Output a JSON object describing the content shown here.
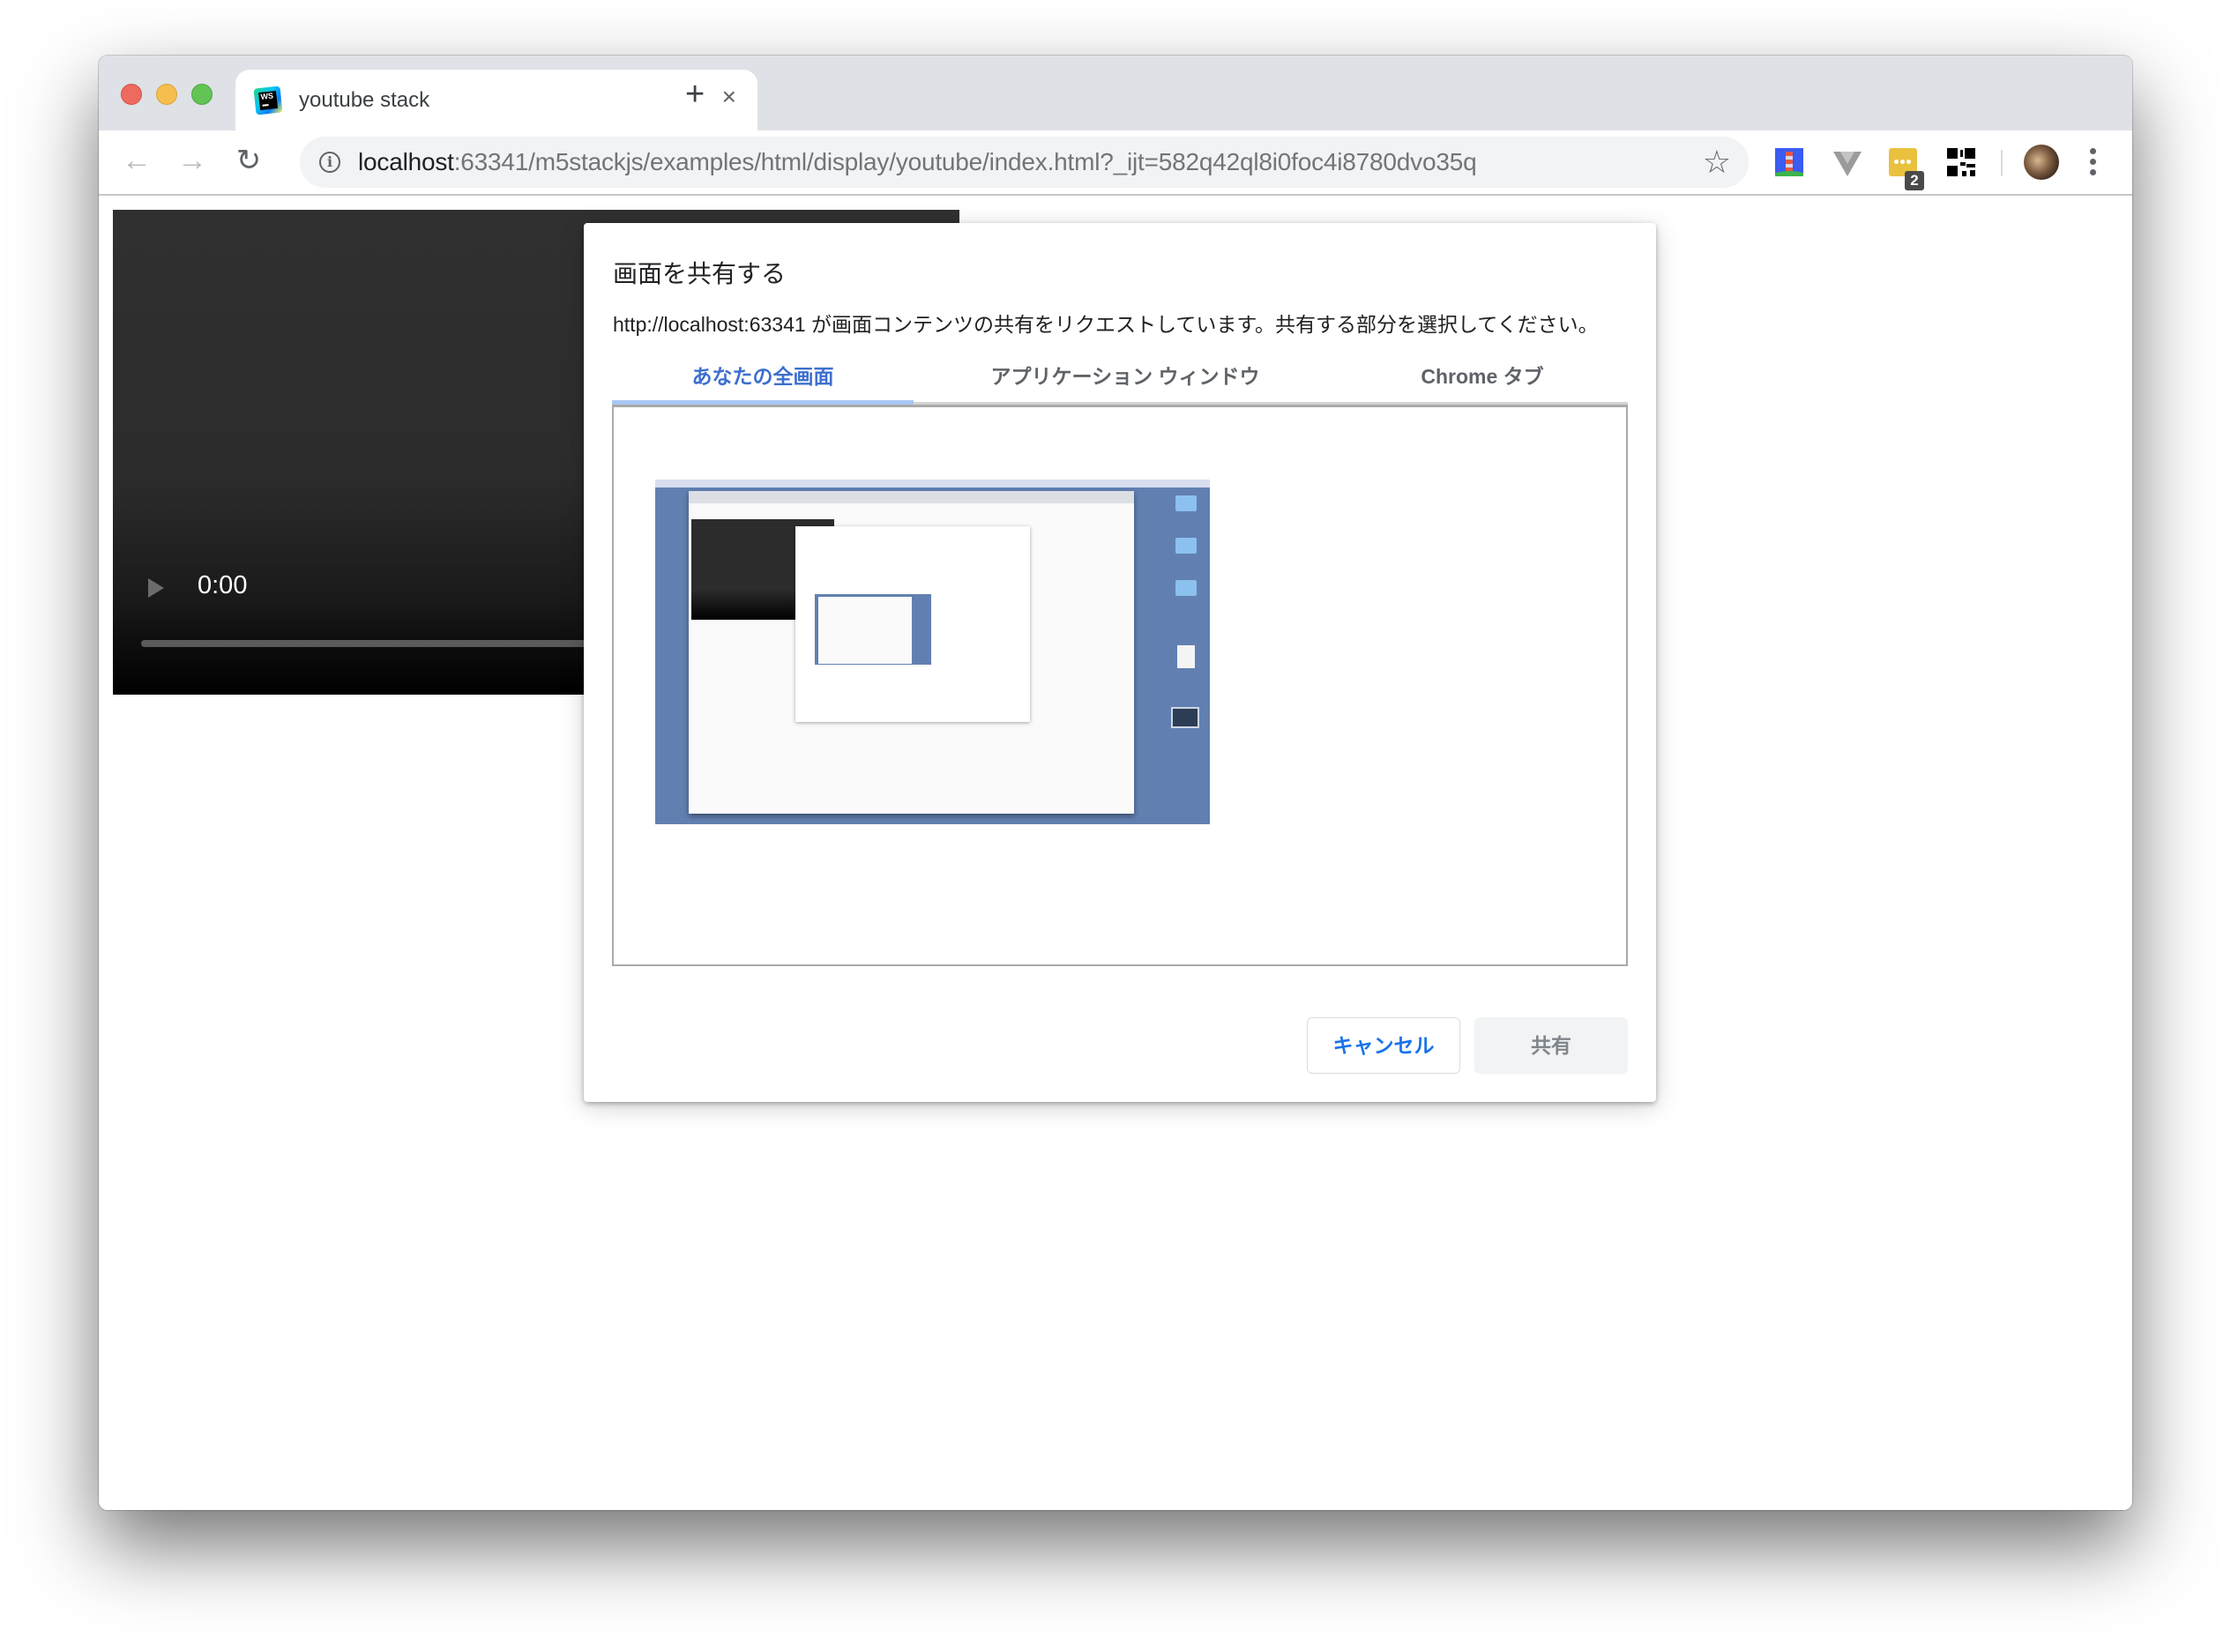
{
  "browser": {
    "tab": {
      "title": "youtube stack",
      "favicon": "webstorm-icon",
      "close_glyph": "×"
    },
    "new_tab_glyph": "+",
    "nav": {
      "back_glyph": "←",
      "forward_glyph": "→",
      "reload_glyph": "↻"
    },
    "omnibox": {
      "info_glyph": "i",
      "url_host": "localhost",
      "url_rest": ":63341/m5stackjs/examples/html/display/youtube/index.html?_ijt=582q42ql8i0foc4i8780dvo35q",
      "star_glyph": "☆"
    },
    "extensions": [
      {
        "name": "lighthouse-extension-icon"
      },
      {
        "name": "vue-devtools-extension-icon"
      },
      {
        "name": "ellipsis-extension-icon",
        "badge": "2"
      },
      {
        "name": "qr-code-extension-icon"
      }
    ],
    "menu_glyph": "⋮"
  },
  "video": {
    "time": "0:00",
    "progress": 0
  },
  "dialog": {
    "title": "画面を共有する",
    "description": "http://localhost:63341 が画面コンテンツの共有をリクエストしています。共有する部分を選択してください。",
    "tabs": [
      {
        "label": "あなたの全画面",
        "selected": true
      },
      {
        "label": "アプリケーション ウィンドウ",
        "selected": false
      },
      {
        "label": "Chrome タブ",
        "selected": false
      }
    ],
    "cancel_label": "キャンセル",
    "share_label": "共有",
    "share_enabled": false
  },
  "colors": {
    "accent_blue": "#1a73e8",
    "selected_tab_text": "#3d6fcf",
    "tab_indicator": "#a8c8f5",
    "tabstrip_bg": "#dee1e6",
    "desktop_bg": "#6180b1"
  }
}
